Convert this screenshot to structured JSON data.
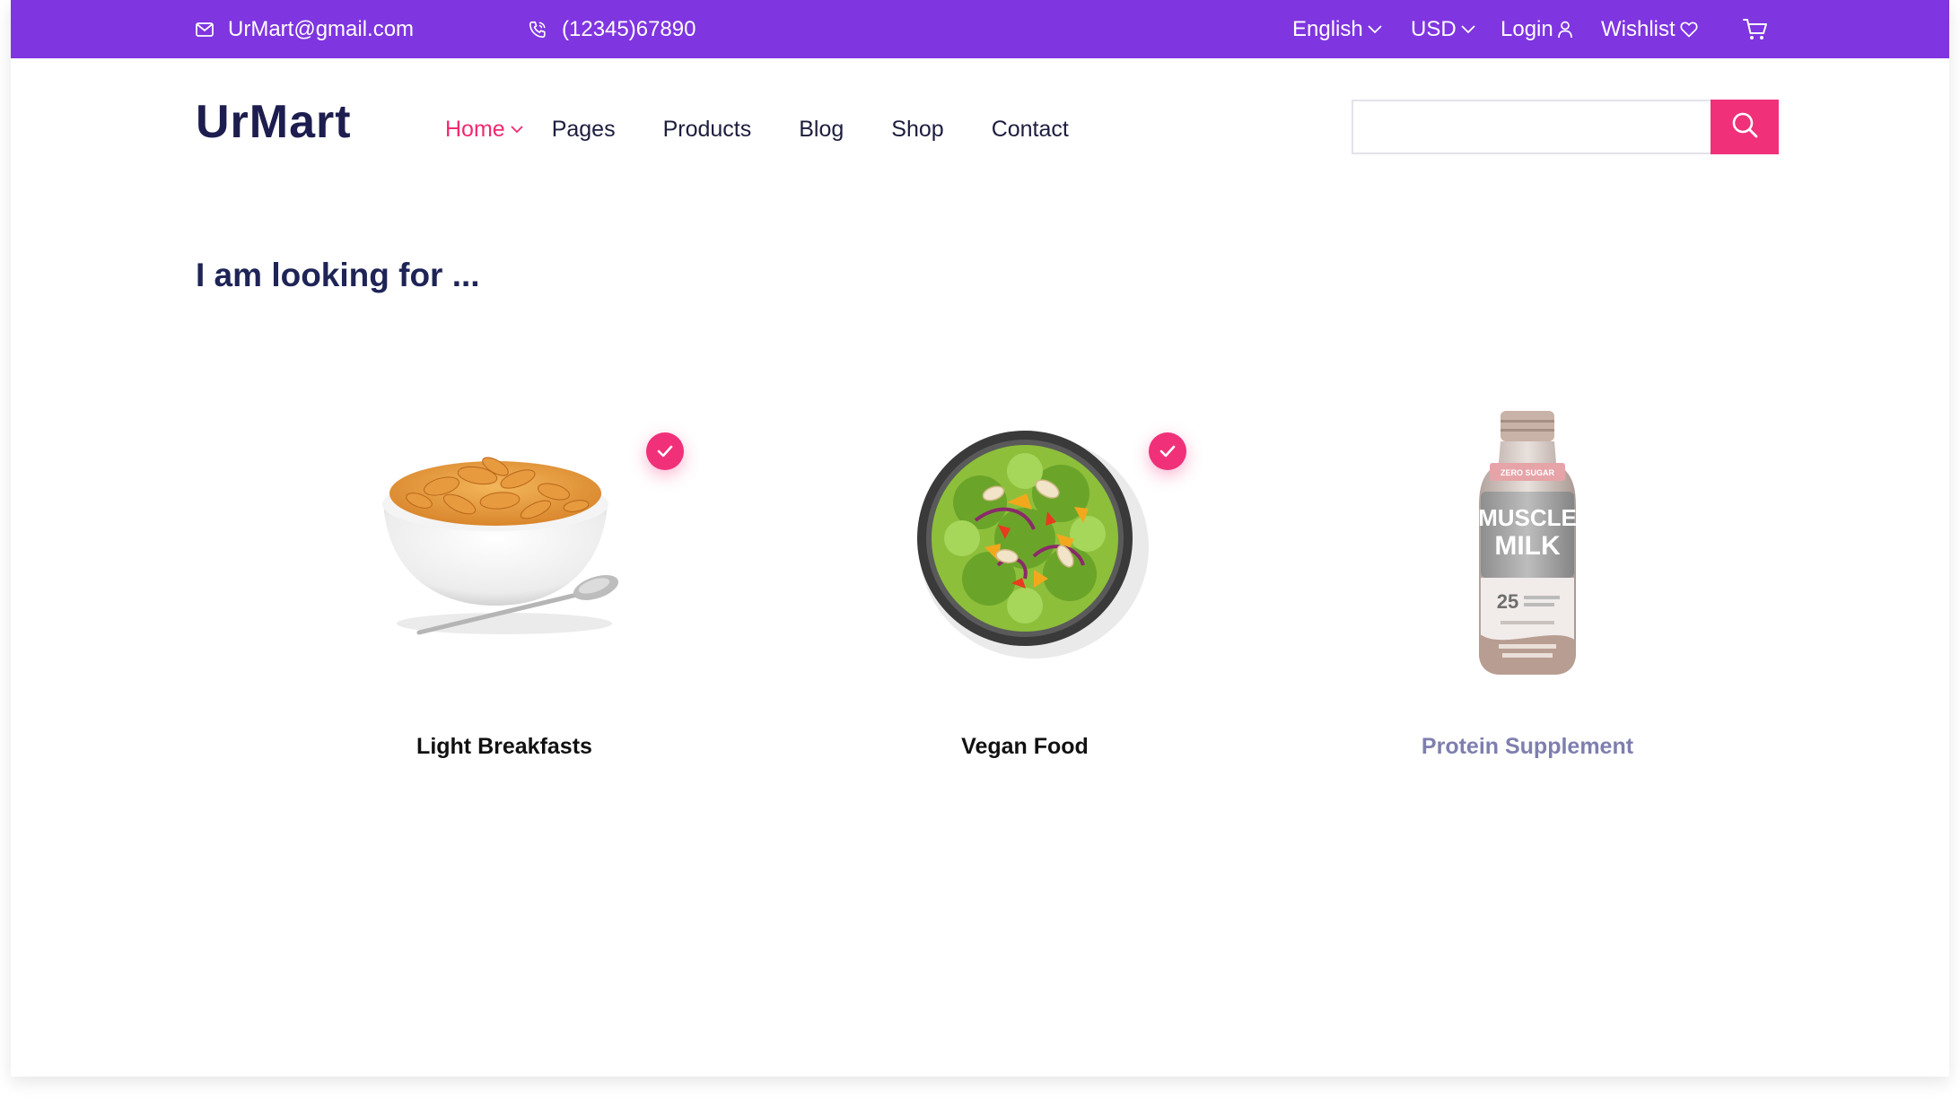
{
  "topbar": {
    "email": "UrMart@gmail.com",
    "phone": "(12345)67890",
    "language": "English",
    "currency": "USD",
    "login": "Login",
    "wishlist": "Wishlist",
    "bg_color": "#7f35e0"
  },
  "header": {
    "logo": "UrMart",
    "nav": [
      "Home",
      "Pages",
      "Products",
      "Blog",
      "Shop",
      "Contact"
    ],
    "active_nav": "Home",
    "search_placeholder": "",
    "accent_color": "#f1307a"
  },
  "main": {
    "title": "I am looking for ...",
    "categories": [
      {
        "label": "Light Breakfasts",
        "selected": true,
        "image": "cereal-bowl"
      },
      {
        "label": "Vegan Food",
        "selected": true,
        "image": "salad-bowl"
      },
      {
        "label": "Protein Supplement",
        "selected": false,
        "image": "protein-shake-bottle"
      }
    ]
  },
  "product_text": {
    "bottle_badge": "ZERO SUGAR",
    "bottle_brand_1": "MUSCLE",
    "bottle_brand_2": "MILK",
    "bottle_protein": "25"
  }
}
